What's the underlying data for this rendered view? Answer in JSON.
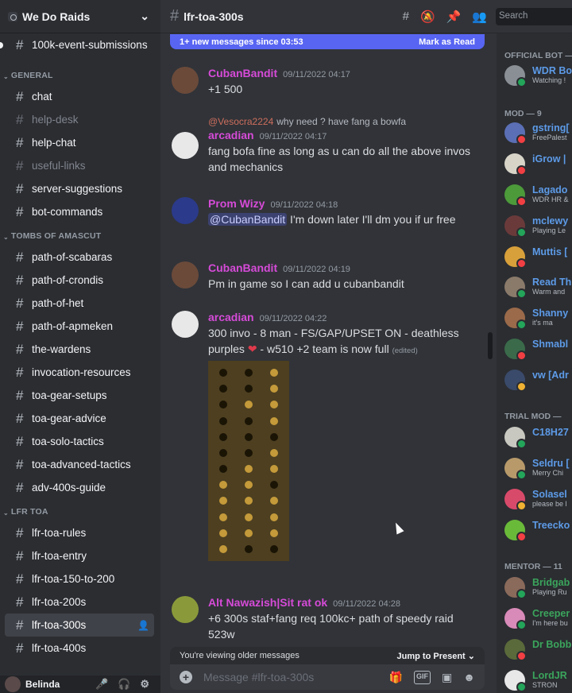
{
  "server": {
    "name": "We Do Raids"
  },
  "sidebar": {
    "top_channel": "100k-event-submissions",
    "categories": [
      {
        "label": "GENERAL",
        "channels": [
          {
            "name": "chat",
            "muted": false
          },
          {
            "name": "help-desk",
            "muted": true
          },
          {
            "name": "help-chat",
            "muted": false
          },
          {
            "name": "useful-links",
            "muted": true
          },
          {
            "name": "server-suggestions",
            "muted": false
          },
          {
            "name": "bot-commands",
            "muted": false
          }
        ]
      },
      {
        "label": "TOMBS OF AMASCUT",
        "channels": [
          {
            "name": "path-of-scabaras"
          },
          {
            "name": "path-of-crondis"
          },
          {
            "name": "path-of-het"
          },
          {
            "name": "path-of-apmeken"
          },
          {
            "name": "the-wardens"
          },
          {
            "name": "invocation-resources"
          },
          {
            "name": "toa-gear-setups"
          },
          {
            "name": "toa-gear-advice"
          },
          {
            "name": "toa-solo-tactics"
          },
          {
            "name": "toa-advanced-tactics"
          },
          {
            "name": "adv-400s-guide"
          }
        ]
      },
      {
        "label": "LFR TOA",
        "channels": [
          {
            "name": "lfr-toa-rules"
          },
          {
            "name": "lfr-toa-entry"
          },
          {
            "name": "lfr-toa-150-to-200"
          },
          {
            "name": "lfr-toa-200s"
          },
          {
            "name": "lfr-toa-300s",
            "active": true
          },
          {
            "name": "lfr-toa-400s"
          }
        ]
      }
    ],
    "user": {
      "name": "Belinda"
    }
  },
  "channel": {
    "name": "lfr-toa-300s"
  },
  "newbar": {
    "text": "1+ new messages since 03:53",
    "action": "Mark as Read"
  },
  "search": {
    "placeholder": "Search"
  },
  "messages": [
    {
      "author": "CubanBandit",
      "time": "09/11/2022 04:17",
      "color": "#d64bd8",
      "text": "+1 500"
    },
    {
      "reply_to": "@Vesocra2224",
      "reply_text": "why need ? have fang a bowfa",
      "author": "arcadian",
      "time": "09/11/2022 04:17",
      "color": "#d64bd8",
      "text": "fang bofa fine as long as u can do all the above invos and mechanics"
    },
    {
      "author": "Prom Wizy",
      "time": "09/11/2022 04:18",
      "color": "#d64bd8",
      "mention": "@CubanBandit",
      "text": " I'm down later I'll dm you if ur free"
    },
    {
      "author": "CubanBandit",
      "time": "09/11/2022 04:19",
      "color": "#d64bd8",
      "text": "Pm in game so I can add u cubanbandit"
    },
    {
      "author": "arcadian",
      "time": "09/11/2022 04:22",
      "color": "#d64bd8",
      "text_a": "300 invo - 8 man - FS/GAP/UPSET ON - deathless purples ",
      "text_b": " - w510  +2 team is now full",
      "edited": "(edited)"
    },
    {
      "author": "Alt Nawazish|Sit rat ok",
      "time": "09/11/2022 04:28",
      "color": "#d64bd8",
      "text": "+6 300s staf+fang req 100kc+ path of speedy raid 523w"
    }
  ],
  "older": {
    "label": "You're viewing older messages",
    "action": "Jump to Present"
  },
  "composer": {
    "placeholder": "Message #lfr-toa-300s",
    "gif": "GIF"
  },
  "members": {
    "official_bot": {
      "label": "OFFICIAL BOT — 1",
      "items": [
        {
          "name": "WDR Bo",
          "status": "Watching !",
          "color": "#5d9be8"
        }
      ]
    },
    "mod": {
      "label": "MOD — 9",
      "items": [
        {
          "name": "gstring[",
          "status": "FreePalest",
          "color": "#5d9be8"
        },
        {
          "name": "iGrow |",
          "status": "",
          "color": "#5d9be8"
        },
        {
          "name": "Lagado",
          "status": "WDR HR &",
          "color": "#5d9be8"
        },
        {
          "name": "mclewy",
          "status": "Playing Le",
          "color": "#5d9be8"
        },
        {
          "name": "Muttis [",
          "status": "",
          "color": "#5d9be8"
        },
        {
          "name": "Read Th",
          "status": "Warm and",
          "color": "#5d9be8"
        },
        {
          "name": "Shanny",
          "status": "it's ma",
          "color": "#5d9be8"
        },
        {
          "name": "Shmabl",
          "status": "",
          "color": "#5d9be8"
        },
        {
          "name": "vw [Adr",
          "status": "",
          "color": "#5d9be8"
        }
      ]
    },
    "trial_mod": {
      "label": "TRIAL MOD —",
      "items": [
        {
          "name": "C18H27",
          "status": "",
          "color": "#5d9be8"
        },
        {
          "name": "Seldru [",
          "status": "Merry Chi",
          "color": "#5d9be8"
        },
        {
          "name": "Solasel",
          "status": "please be l",
          "color": "#5d9be8"
        },
        {
          "name": "Treecko",
          "status": "",
          "color": "#5d9be8"
        }
      ]
    },
    "mentor": {
      "label": "MENTOR — 11",
      "items": [
        {
          "name": "Bridgab",
          "status": "Playing Ru",
          "color": "#3ba55c"
        },
        {
          "name": "Creeper",
          "status": "I'm here bu",
          "color": "#3ba55c"
        },
        {
          "name": "Dr Bobb",
          "status": "",
          "color": "#3ba55c"
        },
        {
          "name": "LordJR",
          "status": "STRON",
          "color": "#3ba55c"
        }
      ]
    }
  }
}
